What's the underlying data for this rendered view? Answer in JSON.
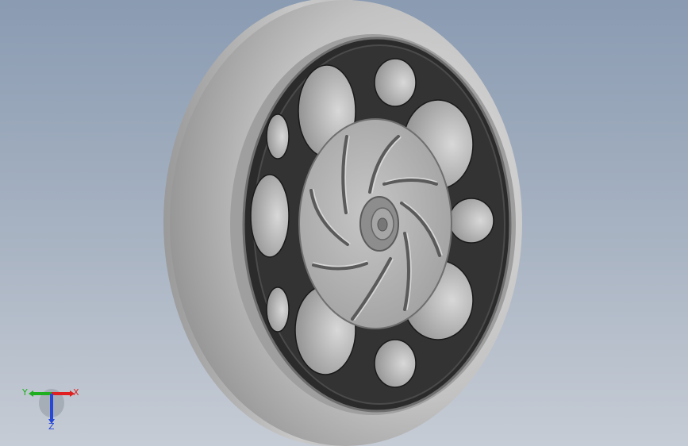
{
  "viewport": {
    "background_top": "#8a9bb2",
    "background_bottom": "#c6ccd5",
    "model": "wheel"
  },
  "triad": {
    "x_label": "X",
    "y_label": "Y",
    "z_label": "Z",
    "x_color": "#e02020",
    "y_color": "#1fae1f",
    "z_color": "#2747d6"
  },
  "colors": {
    "tire": "#bdbdbd",
    "rim": "#2b2b2b",
    "hub": "#a9a9a9",
    "pocket": "#c9c9c9"
  }
}
